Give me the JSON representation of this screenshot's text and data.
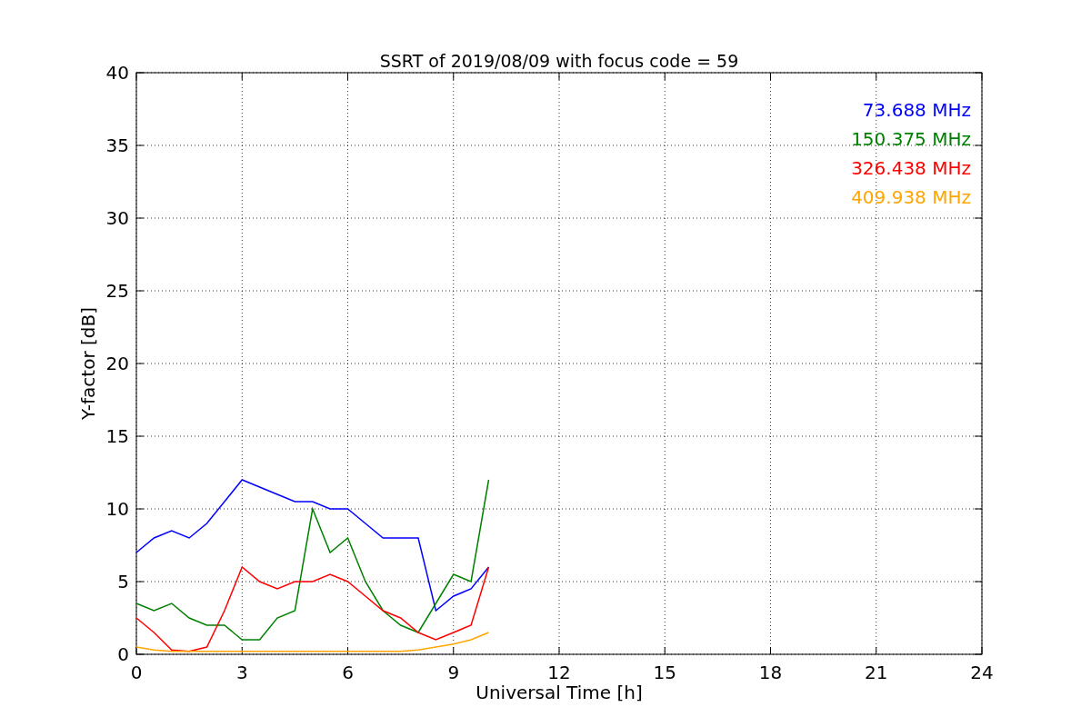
{
  "chart_data": {
    "type": "line",
    "title": "SSRT of 2019/08/09 with focus code = 59",
    "xlabel": "Universal Time [h]",
    "ylabel": "Y-factor [dB]",
    "x": [
      0,
      0.5,
      1,
      1.5,
      2,
      2.5,
      3,
      3.5,
      4,
      4.5,
      5,
      5.5,
      6,
      6.5,
      7,
      7.5,
      8,
      8.5,
      9,
      9.5,
      10
    ],
    "series": [
      {
        "name": "73.688 MHz",
        "color": "#0000ff",
        "values": [
          7,
          8,
          8.5,
          8,
          9,
          10.5,
          12,
          11.5,
          11,
          10.5,
          10.5,
          10,
          10,
          9,
          8,
          8,
          8,
          3,
          4,
          4.5,
          6
        ]
      },
      {
        "name": "150.375 MHz",
        "color": "#008000",
        "values": [
          3.5,
          3,
          3.5,
          2.5,
          2,
          2,
          1,
          1,
          2.5,
          3,
          10,
          7,
          8,
          5,
          3,
          2,
          1.5,
          3.5,
          5.5,
          5,
          12
        ]
      },
      {
        "name": "326.438 MHz",
        "color": "#ff0000",
        "values": [
          2.5,
          1.5,
          0.3,
          0.2,
          0.5,
          3,
          6,
          5,
          4.5,
          5,
          5,
          5.5,
          5,
          4,
          3,
          2.5,
          1.5,
          1,
          1.5,
          2,
          6
        ]
      },
      {
        "name": "409.938 MHz",
        "color": "#ffa500",
        "values": [
          0.5,
          0.3,
          0.2,
          0.2,
          0.2,
          0.2,
          0.2,
          0.2,
          0.2,
          0.2,
          0.2,
          0.2,
          0.2,
          0.2,
          0.2,
          0.2,
          0.3,
          0.5,
          0.7,
          1,
          1.5
        ]
      }
    ],
    "grid": true,
    "xlim": [
      0,
      24
    ],
    "ylim": [
      0,
      40
    ],
    "xticks": [
      0,
      3,
      6,
      9,
      12,
      15,
      18,
      21,
      24
    ],
    "yticks": [
      0,
      5,
      10,
      15,
      20,
      25,
      30,
      35,
      40
    ]
  }
}
